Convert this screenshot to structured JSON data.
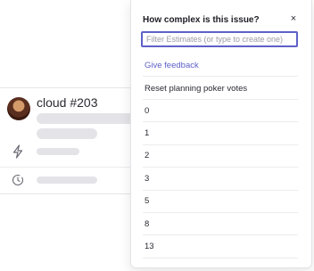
{
  "card": {
    "title": "cloud #203",
    "icons": [
      "avatar",
      "bolt-icon",
      "clock-icon"
    ]
  },
  "popover": {
    "title": "How complex is this issue?",
    "close_label": "×",
    "filter_placeholder": "Filter Estimates (or type to create one)",
    "feedback_label": "Give feedback",
    "reset_label": "Reset planning poker votes",
    "options": [
      "0",
      "1",
      "2",
      "3",
      "5",
      "8",
      "13"
    ]
  },
  "colors": {
    "accent": "#5e61c8",
    "skeleton": "#e4e4e8",
    "text": "#2a2a33"
  }
}
